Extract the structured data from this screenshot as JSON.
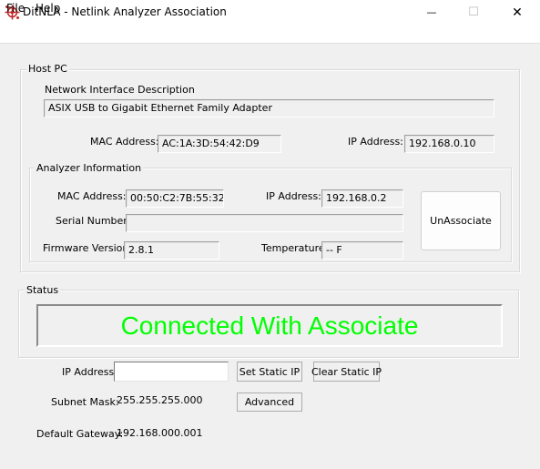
{
  "window": {
    "title": "DitNLA - Netlink Analyzer Association",
    "minimize_glyph": "—",
    "maximize_glyph": "☐",
    "close_glyph": "✕"
  },
  "menu": {
    "file": "File",
    "help": "Help"
  },
  "host_pc": {
    "group_label": "Host PC",
    "nic_label": "Network Interface Description",
    "nic_value": "ASIX USB to Gigabit Ethernet Family Adapter",
    "mac_label": "MAC Address:",
    "mac_value": "AC:1A:3D:54:42:D9",
    "ip_label": "IP Address:",
    "ip_value": "192.168.0.10"
  },
  "analyzer": {
    "group_label": "Analyzer Information",
    "mac_label": "MAC Address:",
    "mac_value": "00:50:C2:7B:55:32",
    "ip_label": "IP Address:",
    "ip_value": "192.168.0.2",
    "serial_label": "Serial Number:",
    "serial_value": "",
    "firmware_label": "Firmware Version:",
    "firmware_value": "2.8.1",
    "temperature_label": "Temperature",
    "temperature_value": "-- F",
    "unassociate_label": "UnAssociate"
  },
  "status": {
    "group_label": "Status",
    "message": "Connected With Associate",
    "message_color": "#00ff00"
  },
  "network": {
    "ip_label": "IP Address:",
    "ip_value": "",
    "set_static_label": "Set Static IP",
    "clear_static_label": "Clear Static IP",
    "subnet_label": "Subnet Mask:",
    "subnet_value": "255.255.255.000",
    "advanced_label": "Advanced",
    "gateway_label": "Default Gateway:",
    "gateway_value": "192.168.000.001"
  },
  "icons": {
    "app": "network-node-icon",
    "minimize": "minimize-icon",
    "maximize": "maximize-icon",
    "close": "close-icon"
  }
}
